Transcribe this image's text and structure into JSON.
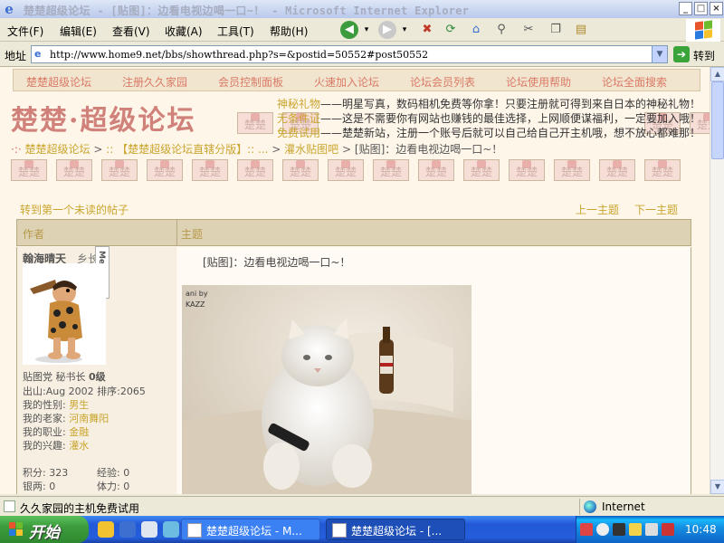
{
  "window": {
    "title": "楚楚超级论坛 - [贴图]：边看电视边喝一口~！ - Microsoft Internet Explorer",
    "buttons": [
      "_",
      "□",
      "×"
    ]
  },
  "menu": {
    "file": "文件(F)",
    "edit": "编辑(E)",
    "view": "查看(V)",
    "favorites": "收藏(A)",
    "tools": "工具(T)",
    "help": "帮助(H)"
  },
  "address": {
    "label": "地址",
    "url": "http://www.home9.net/bbs/showthread.php?s=&postid=50552#post50552",
    "go": "转到"
  },
  "forum": {
    "nav": [
      "楚楚超级论坛",
      "注册久久家园",
      "会员控制面板",
      "火速加入论坛",
      "论坛会员列表",
      "论坛使用帮助",
      "论坛全面搜索"
    ],
    "logo": "楚楚·超级论坛",
    "tile_text": "楚楚",
    "promos": [
      {
        "key": "神秘礼物",
        "text": "——明星写真，数码相机免费等你拿！只要注册就可得到来自日本的神秘礼物！"
      },
      {
        "key": "无条件证",
        "text": "——这是不需要你有网站也赚钱的最佳选择，上网顺便谋福利，一定要加入哦！"
      },
      {
        "key": "免费试用",
        "text": "——楚楚新站，注册一个账号后就可以自己给自己开主机哦，想不放心都难那！"
      }
    ],
    "breadcrumb": [
      "楚楚超级论坛",
      ":: 【楚楚超级论坛直辖分版】:: ...",
      "灌水贴图吧",
      "[贴图]：边看电视边喝一口~！"
    ],
    "actions": {
      "first_unread": "转到第一个未读的帖子",
      "prev": "上一主题",
      "next": "下一主题"
    },
    "table": {
      "author_header": "作者",
      "subject_header": "主题"
    },
    "post": {
      "username": "翰海晴天",
      "user_title": "乡长",
      "menu_tab": "Menu",
      "title": "[贴图]：边看电视边喝一口~！",
      "photo_credit": [
        "ani by",
        "KAZZ"
      ],
      "info": [
        {
          "label": "贴图党 秘书长",
          "value": "0级"
        },
        {
          "label": "出山:Aug 2002 排序:2065",
          "value": ""
        },
        {
          "label": "我的性别:",
          "value": "男生"
        },
        {
          "label": "我的老家:",
          "value": "河南舞阳"
        },
        {
          "label": "我的职业:",
          "value": "金融"
        },
        {
          "label": "我的兴趣:",
          "value": "灌水"
        }
      ],
      "stats": [
        {
          "label": "积分:",
          "value": "323",
          "label2": "经验:",
          "value2": "0"
        },
        {
          "label": "银两:",
          "value": "0",
          "label2": "体力:",
          "value2": "0"
        }
      ]
    }
  },
  "status": {
    "text": "久久家园的主机免费试用",
    "zone": "Internet"
  },
  "taskbar": {
    "start": "开始",
    "tasks": [
      "楚楚超级论坛 - M...",
      "楚楚超级论坛 - [..."
    ],
    "time": "10:48"
  }
}
